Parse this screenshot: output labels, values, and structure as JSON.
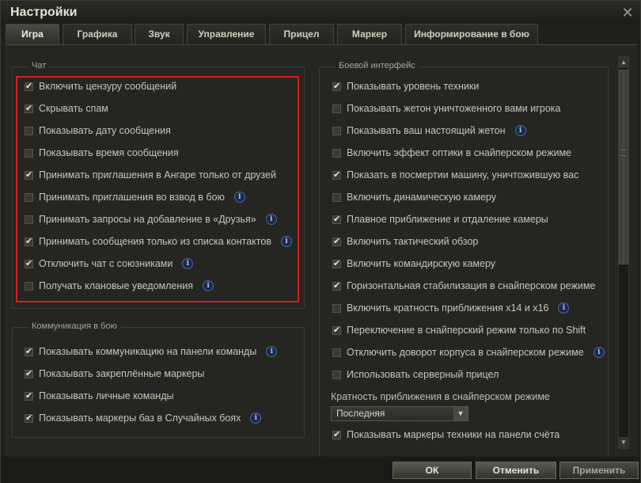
{
  "window": {
    "title": "Настройки",
    "close_label": "✕"
  },
  "tabs": [
    {
      "label": "Игра",
      "active": true
    },
    {
      "label": "Графика"
    },
    {
      "label": "Звук"
    },
    {
      "label": "Управление"
    },
    {
      "label": "Прицел"
    },
    {
      "label": "Маркер"
    },
    {
      "label": "Информирование в бою"
    }
  ],
  "chat": {
    "title": "Чат",
    "items": [
      {
        "label": "Включить цензуру сообщений",
        "checked": true
      },
      {
        "label": "Скрывать спам",
        "checked": true
      },
      {
        "label": "Показывать дату сообщения",
        "checked": false
      },
      {
        "label": "Показывать время сообщения",
        "checked": false
      },
      {
        "label": "Принимать приглашения в Ангаре только от друзей",
        "checked": true
      },
      {
        "label": "Принимать приглашения во взвод в бою",
        "checked": false,
        "info": true
      },
      {
        "label": "Принимать запросы на добавление в «Друзья»",
        "checked": false,
        "info": true
      },
      {
        "label": "Принимать сообщения только из списка контактов",
        "checked": true,
        "info": true
      },
      {
        "label": "Отключить чат с союзниками",
        "checked": true,
        "info": true
      },
      {
        "label": "Получать клановые уведомления",
        "checked": false,
        "info": true
      }
    ]
  },
  "communication": {
    "title": "Коммуникация в бою",
    "items": [
      {
        "label": "Показывать коммуникацию на панели команды",
        "checked": true,
        "info": true
      },
      {
        "label": "Показывать закреплённые маркеры",
        "checked": true
      },
      {
        "label": "Показывать личные команды",
        "checked": true
      },
      {
        "label": "Показывать маркеры баз в Случайных боях",
        "checked": true,
        "info": true
      }
    ]
  },
  "battle": {
    "title": "Боевой интерфейс",
    "items": [
      {
        "label": "Показывать уровень техники",
        "checked": true
      },
      {
        "label": "Показывать жетон уничтоженного вами игрока",
        "checked": false
      },
      {
        "label": "Показывать ваш настоящий жетон",
        "checked": false,
        "info": true
      },
      {
        "label": "Включить эффект оптики в снайперском режиме",
        "checked": false
      },
      {
        "label": "Показать в посмертии машину, уничтожившую вас",
        "checked": true
      },
      {
        "label": "Включить динамическую камеру",
        "checked": false
      },
      {
        "label": "Плавное приближение и отдаление камеры",
        "checked": true
      },
      {
        "label": "Включить тактический обзор",
        "checked": true
      },
      {
        "label": "Включить командирскую камеру",
        "checked": true
      },
      {
        "label": "Горизонтальная стабилизация в снайперском режиме",
        "checked": true
      },
      {
        "label": "Включить кратность приближения x14 и x16",
        "checked": false,
        "info": true
      },
      {
        "label": "Переключение в снайперский режим только по Shift",
        "checked": true
      },
      {
        "label": "Отключить доворот корпуса в снайперском режиме",
        "checked": false,
        "info": true
      },
      {
        "label": "Использовать серверный прицел",
        "checked": false
      }
    ],
    "zoom_label": "Кратность приближения в снайперском режиме",
    "zoom_value": "Последняя",
    "last_item": {
      "label": "Показывать маркеры техники на панели счёта",
      "checked": true
    }
  },
  "footer": {
    "ok": "ОК",
    "cancel": "Отменить",
    "apply": "Применить"
  },
  "colors": {
    "highlight": "#d81e1e",
    "info": "#4a6aa0"
  },
  "icons": {
    "info": "i",
    "dropdown": "▼",
    "scroll_up": "▲",
    "scroll_down": "▼"
  }
}
